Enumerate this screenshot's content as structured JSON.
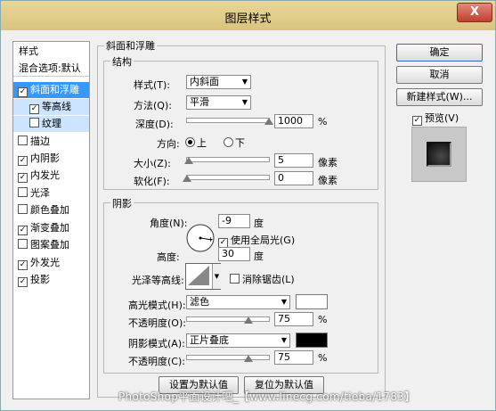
{
  "window": {
    "title": "图层样式",
    "close_glyph": "X"
  },
  "sidebar": {
    "items": [
      {
        "label": "样式",
        "checkbox": false
      },
      {
        "label": "混合选项:默认",
        "checkbox": false
      },
      {
        "label": "斜面和浮雕",
        "checkbox": true,
        "checked": true,
        "selected": true
      },
      {
        "label": "等高线",
        "checkbox": true,
        "checked": true,
        "sub": true
      },
      {
        "label": "纹理",
        "checkbox": true,
        "checked": false,
        "sub": true
      },
      {
        "label": "描边",
        "checkbox": true,
        "checked": false
      },
      {
        "label": "内阴影",
        "checkbox": true,
        "checked": true
      },
      {
        "label": "内发光",
        "checkbox": true,
        "checked": true
      },
      {
        "label": "光泽",
        "checkbox": true,
        "checked": false
      },
      {
        "label": "颜色叠加",
        "checkbox": true,
        "checked": false
      },
      {
        "label": "渐变叠加",
        "checkbox": true,
        "checked": true
      },
      {
        "label": "图案叠加",
        "checkbox": true,
        "checked": false
      },
      {
        "label": "外发光",
        "checkbox": true,
        "checked": true
      },
      {
        "label": "投影",
        "checkbox": true,
        "checked": true
      }
    ]
  },
  "bevel": {
    "group_title": "斜面和浮雕",
    "structure": {
      "title": "结构",
      "style_label": "样式(T):",
      "style_value": "内斜面",
      "technique_label": "方法(Q):",
      "technique_value": "平滑",
      "depth_label": "深度(D):",
      "depth_value": "1000",
      "depth_unit": "%",
      "depth_level_percent": 100,
      "direction_label": "方向:",
      "direction_up": "上",
      "direction_down": "下",
      "direction_selected": "上",
      "size_label": "大小(Z):",
      "size_value": "5",
      "size_unit": "像素",
      "size_level_percent": 2,
      "soften_label": "软化(F):",
      "soften_value": "0",
      "soften_unit": "像素",
      "soften_level_percent": 0
    },
    "shading": {
      "title": "阴影",
      "angle_label": "角度(N):",
      "angle_value": "-9",
      "angle_unit": "度",
      "global_light_label": "使用全局光(G)",
      "global_light_checked": true,
      "altitude_label": "高度:",
      "altitude_value": "30",
      "altitude_unit": "度",
      "gloss_contour_label": "光泽等高线:",
      "anti_aliased_label": "消除锯齿(L)",
      "anti_aliased_checked": false,
      "highlight_mode_label": "高光模式(H):",
      "highlight_mode_value": "滤色",
      "highlight_color": "#ffffff",
      "highlight_opacity_label": "不透明度(O):",
      "highlight_opacity_value": "75",
      "highlight_opacity_unit": "%",
      "highlight_opacity_level_percent": 75,
      "shadow_mode_label": "阴影模式(A):",
      "shadow_mode_value": "正片叠底",
      "shadow_color": "#000000",
      "shadow_opacity_label": "不透明度(C):",
      "shadow_opacity_value": "75",
      "shadow_opacity_unit": "%",
      "shadow_opacity_level_percent": 75
    },
    "make_default_label": "设置为默认值",
    "reset_default_label": "复位为默认值"
  },
  "right": {
    "ok_label": "确定",
    "cancel_label": "取消",
    "new_style_label": "新建样式(W)...",
    "preview_label": "预览(V)",
    "preview_checked": true
  },
  "watermark": "PhotoShop平面设计吧_【www.linecg.com/tieba/1783】"
}
